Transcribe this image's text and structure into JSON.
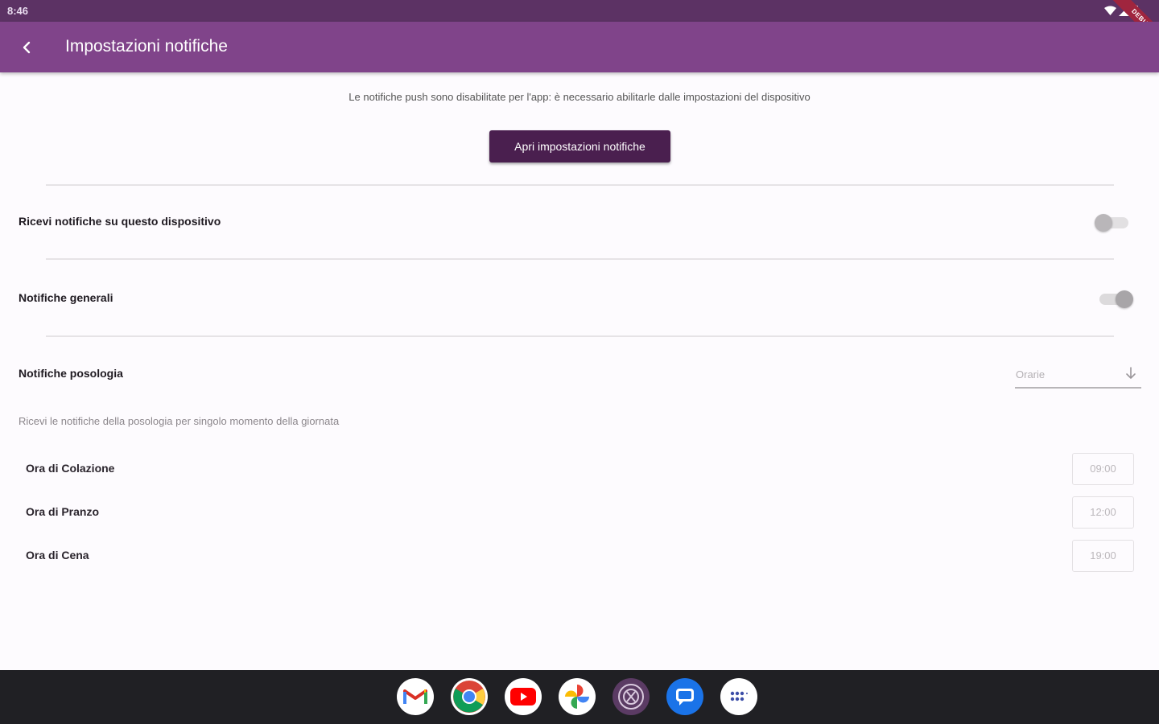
{
  "status_bar": {
    "time": "8:46",
    "debug_banner": "DEBUG"
  },
  "app_bar": {
    "title": "Impostazioni notifiche"
  },
  "banner": {
    "message": "Le notifiche push sono disabilitate per l'app: è necessario abilitarle dalle impostazioni del dispositivo",
    "button_label": "Apri impostazioni notifiche"
  },
  "settings": {
    "device_notifications": {
      "label": "Ricevi notifiche su questo dispositivo",
      "enabled": false
    },
    "general_notifications": {
      "label": "Notifiche generali",
      "enabled": true
    },
    "dosage_notifications": {
      "label": "Notifiche posologia",
      "select_value": "Orarie",
      "description": "Ricevi le notifiche della posologia per singolo momento della giornata"
    }
  },
  "times": [
    {
      "label": "Ora di Colazione",
      "value": "09:00"
    },
    {
      "label": "Ora di Pranzo",
      "value": "12:00"
    },
    {
      "label": "Ora di Cena",
      "value": "19:00"
    }
  ],
  "dock": [
    {
      "name": "gmail-icon"
    },
    {
      "name": "chrome-icon"
    },
    {
      "name": "youtube-icon"
    },
    {
      "name": "photos-icon"
    },
    {
      "name": "app-icon"
    },
    {
      "name": "messages-icon"
    },
    {
      "name": "app-drawer-icon"
    }
  ],
  "colors": {
    "status_bar": "#5c3264",
    "app_bar": "#80448a",
    "primary_button": "#4a1f4f",
    "nav_bar": "#202024"
  }
}
